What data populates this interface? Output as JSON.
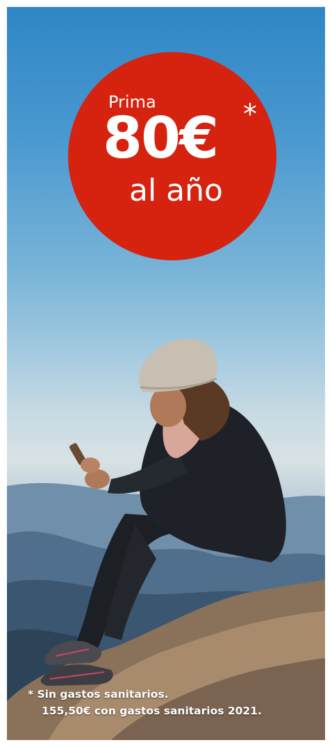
{
  "offer": {
    "prefix": "Prima",
    "amount": "80€",
    "asterisk": "*",
    "period": "al año"
  },
  "footnote": {
    "mark": "*",
    "line1": "Sin gastos sanitarios.",
    "line2": "155,50€ con gastos sanitarios 2021."
  },
  "colors": {
    "badge": "#d52310",
    "sky_top": "#2f86c6",
    "text": "#ffffff"
  }
}
